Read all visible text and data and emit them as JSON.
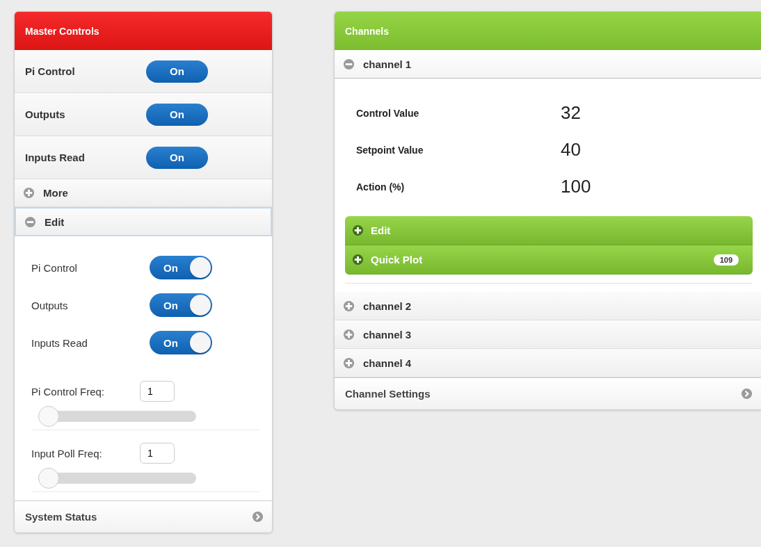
{
  "master_controls": {
    "title": "Master Controls",
    "rows": [
      {
        "label": "Pi Control",
        "on": true,
        "toggle_label": "On"
      },
      {
        "label": "Outputs",
        "on": true,
        "toggle_label": "On"
      },
      {
        "label": "Inputs Read",
        "on": true,
        "toggle_label": "On"
      }
    ],
    "sections": [
      {
        "label": "More",
        "expanded": false
      },
      {
        "label": "Edit",
        "expanded": true
      }
    ],
    "switches": [
      {
        "label": "Pi Control",
        "on": true,
        "switch_label": "On"
      },
      {
        "label": "Outputs",
        "on": true,
        "switch_label": "On"
      },
      {
        "label": "Inputs Read",
        "on": true,
        "switch_label": "On"
      }
    ],
    "fields": [
      {
        "label": "Pi Control Freq:",
        "value": "1",
        "level": 0
      },
      {
        "label": "Input Poll Freq:",
        "value": "1",
        "level": 0
      }
    ],
    "footer": "System Status"
  },
  "channels": {
    "title": "Channels",
    "items": [
      {
        "label": "channel 1",
        "expanded": true,
        "readings": [
          {
            "label": "Control Value",
            "value": "32"
          },
          {
            "label": "Setpoint Value",
            "value": "40"
          },
          {
            "label": "Action (%)",
            "value": "100"
          }
        ],
        "subsections": [
          {
            "label": "Edit",
            "expanded": false
          },
          {
            "label": "Quick Plot",
            "expanded": false,
            "count": "109"
          }
        ]
      },
      {
        "label": "channel 2",
        "expanded": false
      },
      {
        "label": "channel 3",
        "expanded": false
      },
      {
        "label": "channel 4",
        "expanded": false
      }
    ],
    "footer": "Channel Settings"
  }
}
